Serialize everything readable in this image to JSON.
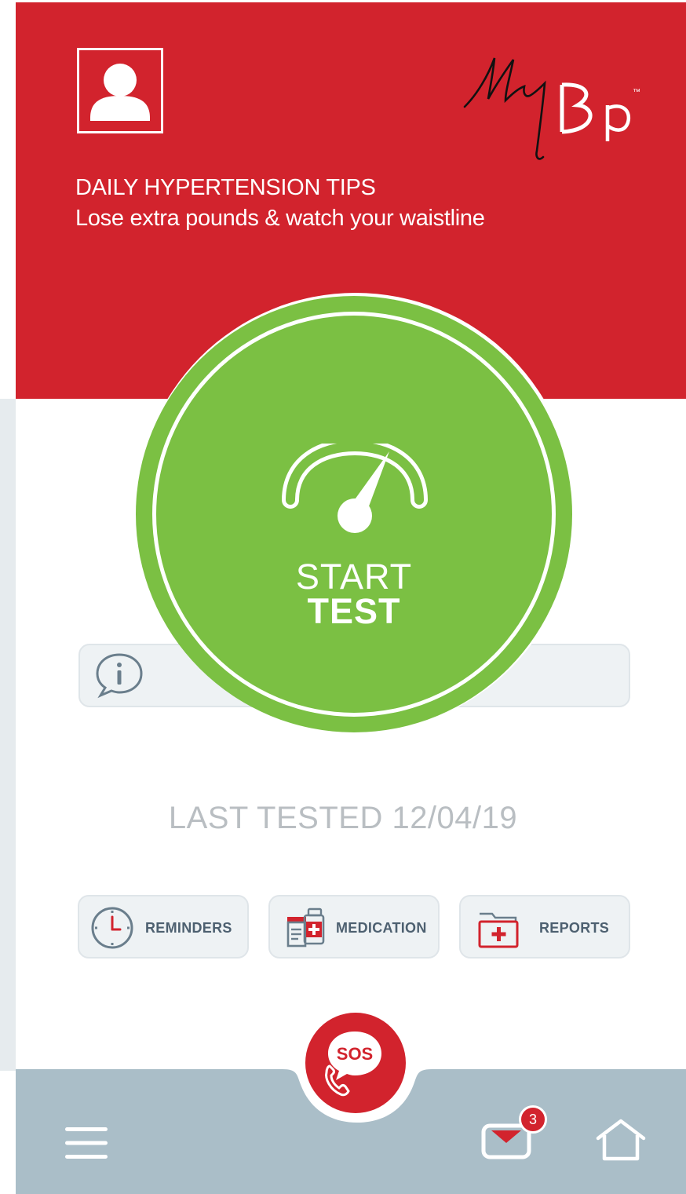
{
  "app": {
    "logo_text": "MyBp",
    "trademark": "™"
  },
  "tips": {
    "title": "DAILY HYPERTENSION TIPS",
    "text": "Lose extra pounds & watch your waistline"
  },
  "test_button": {
    "line1": "START",
    "line2": "TEST"
  },
  "last_tested": "LAST TESTED 12/04/19",
  "actions": [
    {
      "label": "REMINDERS",
      "icon": "clock-icon"
    },
    {
      "label": "MEDICATION",
      "icon": "medication-icon"
    },
    {
      "label": "REPORTS",
      "icon": "reports-folder-icon"
    }
  ],
  "sos": {
    "label": "SOS"
  },
  "nav": {
    "mail_badge": "3"
  },
  "colors": {
    "brand_red": "#d2232d",
    "test_green": "#7bc043",
    "nav_grey": "#aabec8",
    "action_text": "#4d6070"
  }
}
